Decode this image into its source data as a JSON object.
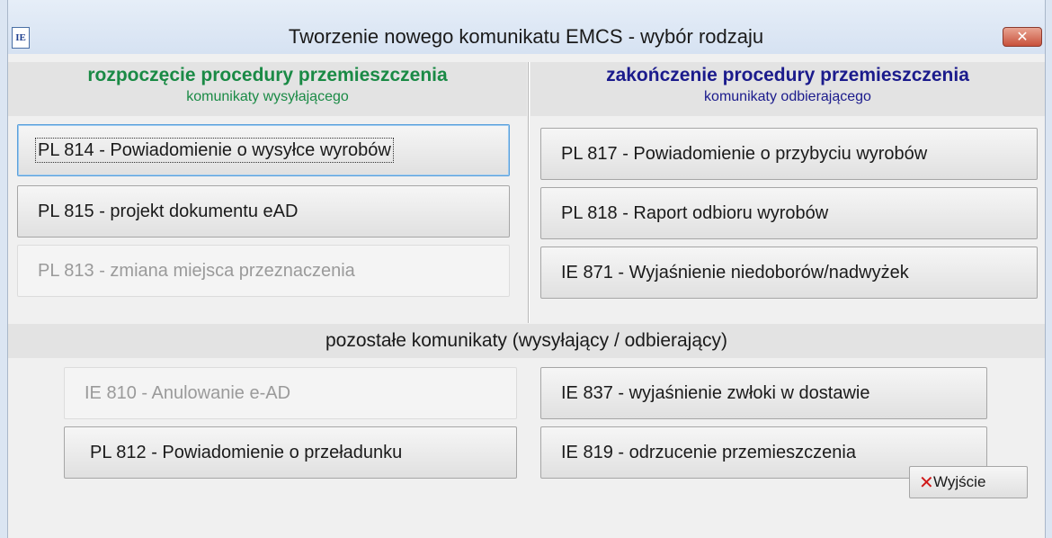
{
  "window": {
    "title": "Tworzenie nowego komunikatu EMCS - wybór rodzaju",
    "icon": "IE",
    "close_label": "✕"
  },
  "sender": {
    "heading": "rozpoczęcie procedury przemieszczenia",
    "subheading": "komunikaty wysyłającego",
    "buttons": [
      {
        "label": "PL 814 - Powiadomienie o wysyłce wyrobów",
        "enabled": true,
        "focused": true
      },
      {
        "label": "PL 815 - projekt dokumentu eAD",
        "enabled": true
      },
      {
        "label": "PL 813 - zmiana miejsca przeznaczenia",
        "enabled": false
      }
    ]
  },
  "receiver": {
    "heading": "zakończenie  procedury przemieszczenia",
    "subheading": "komunikaty odbierającego",
    "buttons": [
      {
        "label": "PL 817 - Powiadomienie o przybyciu wyrobów",
        "enabled": true
      },
      {
        "label": "PL 818 - Raport odbioru wyrobów",
        "enabled": true
      },
      {
        "label": "IE  871 - Wyjaśnienie niedoborów/nadwyżek",
        "enabled": true
      }
    ]
  },
  "other": {
    "heading": "pozostałe komunikaty (wysyłający / odbierający)",
    "buttons": [
      {
        "label": "IE  810 - Anulowanie e-AD",
        "enabled": false
      },
      {
        "label": "IE  837 - wyjaśnienie zwłoki w dostawie",
        "enabled": true
      },
      {
        "label": "PL 812 - Powiadomienie o przeładunku",
        "enabled": true
      },
      {
        "label": "IE  819 - odrzucenie przemieszczenia",
        "enabled": true
      }
    ]
  },
  "exit": {
    "label": "Wyjście",
    "icon": "close-x-icon"
  },
  "colors": {
    "sender_heading": "#1a8a45",
    "receiver_heading": "#1b1b8c",
    "exit_icon": "#d01818"
  }
}
